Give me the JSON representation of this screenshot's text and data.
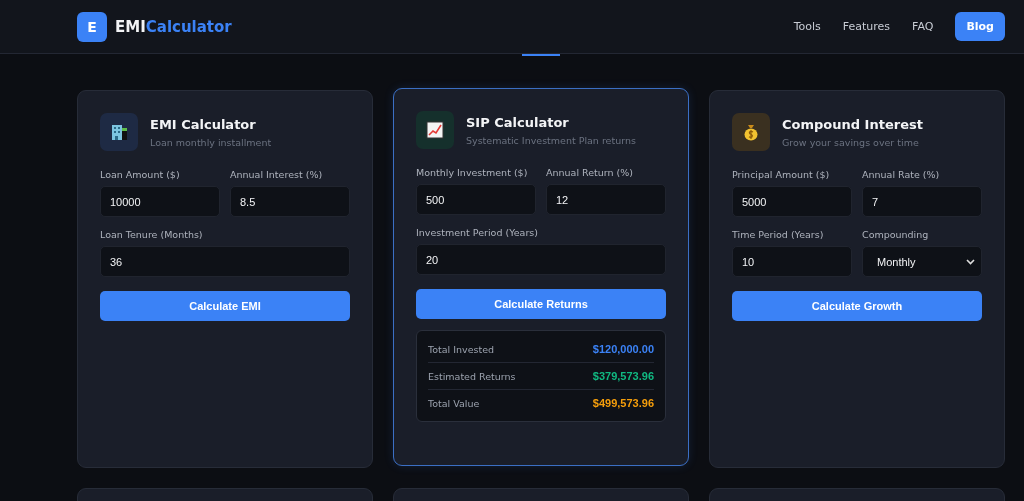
{
  "header": {
    "logo_letter": "E",
    "brand_main": "EMI",
    "brand_accent": "Calculator",
    "nav": [
      {
        "label": "Tools",
        "kind": "link"
      },
      {
        "label": "Features",
        "kind": "link"
      },
      {
        "label": "FAQ",
        "kind": "link"
      },
      {
        "label": "Blog",
        "kind": "button"
      }
    ]
  },
  "cards": [
    {
      "title": "EMI Calculator",
      "subtitle": "Loan monthly installment",
      "selected": false,
      "fields": [
        {
          "label": "Loan Amount ($)",
          "value": "10000",
          "kind": "input"
        },
        {
          "label": "Annual Interest (%)",
          "value": "8.5",
          "kind": "input"
        },
        {
          "label": "Loan Tenure (Months)",
          "value": "36",
          "kind": "input",
          "wide": true
        }
      ],
      "button": "Calculate EMI"
    },
    {
      "title": "SIP Calculator",
      "subtitle": "Systematic Investment Plan returns",
      "selected": true,
      "fields": [
        {
          "label": "Monthly Investment ($)",
          "value": "500",
          "kind": "input"
        },
        {
          "label": "Annual Return (%)",
          "value": "12",
          "kind": "input"
        },
        {
          "label": "Investment Period (Years)",
          "value": "20",
          "kind": "input",
          "wide": true
        }
      ],
      "button": "Calculate Returns",
      "results": [
        {
          "label": "Total Invested",
          "value": "$120,000.00",
          "color": "#3b82f6"
        },
        {
          "label": "Estimated Returns",
          "value": "$379,573.96",
          "color": "#10b981"
        },
        {
          "label": "Total Value",
          "value": "$499,573.96",
          "color": "#f59e0b"
        }
      ]
    },
    {
      "title": "Compound Interest",
      "subtitle": "Grow your savings over time",
      "selected": false,
      "fields": [
        {
          "label": "Principal Amount ($)",
          "value": "5000",
          "kind": "input"
        },
        {
          "label": "Annual Rate (%)",
          "value": "7",
          "kind": "input"
        },
        {
          "label": "Time Period (Years)",
          "value": "10",
          "kind": "input"
        },
        {
          "label": "Compounding",
          "value": "Monthly",
          "kind": "select"
        }
      ],
      "button": "Calculate Growth"
    }
  ]
}
